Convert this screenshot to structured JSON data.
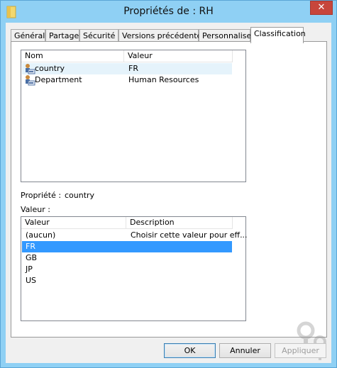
{
  "window": {
    "title": "Propriétés de : RH",
    "close_glyph": "✕"
  },
  "tabs": [
    {
      "label": "Général"
    },
    {
      "label": "Partage"
    },
    {
      "label": "Sécurité"
    },
    {
      "label": "Versions précédentes"
    },
    {
      "label": "Personnaliser"
    },
    {
      "label": "Classification"
    }
  ],
  "properties_list": {
    "columns": [
      "Nom",
      "Valeur"
    ],
    "rows": [
      {
        "name": "country",
        "value": "FR"
      },
      {
        "name": "Department",
        "value": "Human Resources"
      }
    ]
  },
  "property": {
    "label": "Propriété :",
    "value": "country"
  },
  "value_label": "Valeur :",
  "values_list": {
    "columns": [
      "Valeur",
      "Description"
    ],
    "rows": [
      {
        "value": "(aucun)",
        "description": "Choisir cette valeur pour eff..."
      },
      {
        "value": "FR",
        "description": ""
      },
      {
        "value": "GB",
        "description": ""
      },
      {
        "value": "JP",
        "description": ""
      },
      {
        "value": "US",
        "description": ""
      }
    ]
  },
  "buttons": {
    "ok": "OK",
    "cancel": "Annuler",
    "apply": "Appliquer"
  }
}
